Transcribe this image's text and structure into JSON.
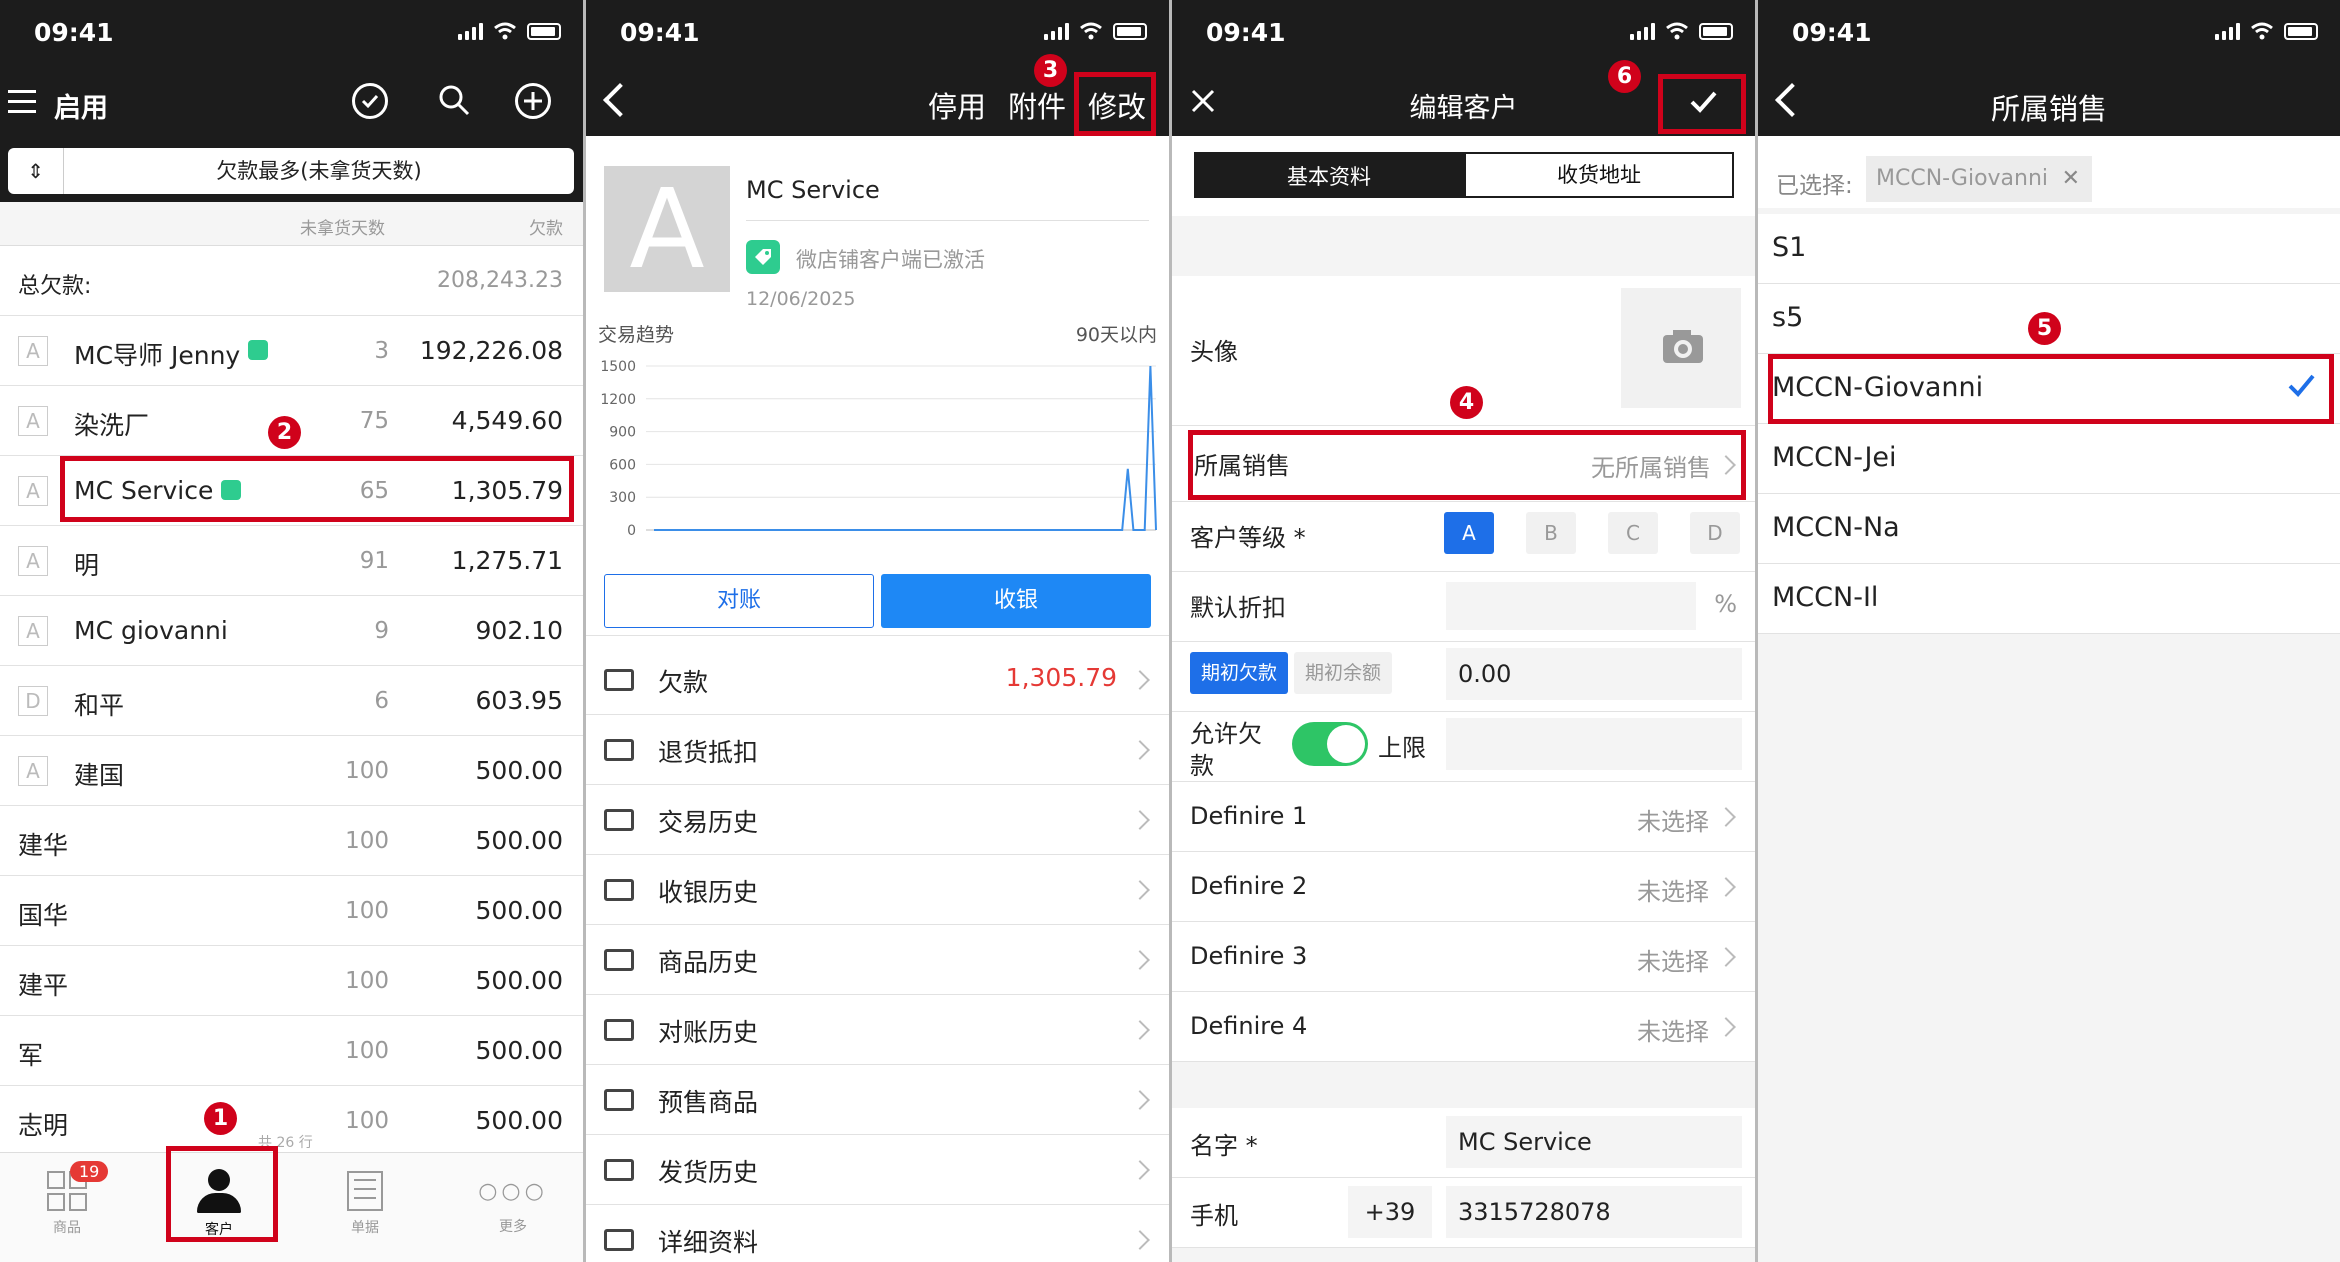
{
  "status_time": "09:41",
  "screen1": {
    "title": "启用",
    "sort_label": "欠款最多(未拿货天数)",
    "col_days": "未拿货天数",
    "col_debt": "欠款",
    "total_label": "总欠款:",
    "total_value": "208,243.23",
    "customers": [
      {
        "badge": "A",
        "name": "MC导师 Jenny",
        "verified": true,
        "days": "3",
        "amount": "192,226.08"
      },
      {
        "badge": "A",
        "name": "染洗厂",
        "verified": false,
        "days": "75",
        "amount": "4,549.60"
      },
      {
        "badge": "A",
        "name": "MC Service",
        "verified": true,
        "days": "65",
        "amount": "1,305.79"
      },
      {
        "badge": "A",
        "name": "明",
        "verified": false,
        "days": "91",
        "amount": "1,275.71"
      },
      {
        "badge": "A",
        "name": "MC giovanni",
        "verified": false,
        "days": "9",
        "amount": "902.10"
      },
      {
        "badge": "D",
        "name": "和平",
        "verified": false,
        "days": "6",
        "amount": "603.95"
      },
      {
        "badge": "A",
        "name": "建国",
        "verified": false,
        "days": "100",
        "amount": "500.00"
      },
      {
        "badge": "",
        "name": "建华",
        "verified": false,
        "days": "100",
        "amount": "500.00"
      },
      {
        "badge": "",
        "name": "国华",
        "verified": false,
        "days": "100",
        "amount": "500.00"
      },
      {
        "badge": "",
        "name": "建平",
        "verified": false,
        "days": "100",
        "amount": "500.00"
      },
      {
        "badge": "",
        "name": "军",
        "verified": false,
        "days": "100",
        "amount": "500.00"
      },
      {
        "badge": "",
        "name": "志明",
        "verified": false,
        "days": "100",
        "amount": "500.00"
      }
    ],
    "row_count": "共 26 行",
    "tabs": [
      {
        "label": "商品",
        "icon": "grid-icon"
      },
      {
        "label": "客户",
        "icon": "person-icon"
      },
      {
        "label": "单据",
        "icon": "list-doc-icon"
      },
      {
        "label": "更多",
        "icon": "more-dots-icon"
      }
    ],
    "tab_badge": "19",
    "marks": {
      "m1": "1",
      "m2": "2"
    }
  },
  "screen2": {
    "actions": {
      "disable": "停用",
      "attach": "附件",
      "edit": "修改"
    },
    "avatar_letter": "A",
    "customer_name": "MC Service",
    "activated": "微店铺客户端已激活",
    "date": "12/06/2025",
    "trend_label": "交易趋势",
    "trend_range": "90天以内",
    "chart_data": {
      "type": "line",
      "y_ticks": [
        "1500",
        "1200",
        "900",
        "600",
        "300",
        "0"
      ],
      "ylim": [
        0,
        1500
      ],
      "values": [
        0,
        0,
        0,
        0,
        0,
        0,
        0,
        0,
        0,
        0,
        0,
        0,
        0,
        0,
        0,
        0,
        0,
        0,
        0,
        0,
        0,
        0,
        0,
        0,
        0,
        0,
        0,
        0,
        0,
        0,
        0,
        0,
        0,
        0,
        0,
        0,
        0,
        0,
        0,
        0,
        0,
        0,
        0,
        0,
        0,
        0,
        0,
        0,
        0,
        0,
        0,
        0,
        0,
        0,
        0,
        0,
        0,
        0,
        0,
        0,
        0,
        0,
        0,
        0,
        0,
        0,
        0,
        0,
        0,
        0,
        0,
        0,
        0,
        0,
        0,
        0,
        0,
        0,
        0,
        0,
        0,
        0,
        0,
        0,
        560,
        0,
        0,
        0,
        1500,
        0
      ]
    },
    "btn_reconcile": "对账",
    "btn_collect": "收银",
    "menu": [
      {
        "icon": "money-icon",
        "label": "欠款",
        "value": "1,305.79"
      },
      {
        "icon": "bag-icon",
        "label": "退货抵扣",
        "value": ""
      },
      {
        "icon": "list-icon",
        "label": "交易历史",
        "value": ""
      },
      {
        "icon": "cash-hand-icon",
        "label": "收银历史",
        "value": ""
      },
      {
        "icon": "cart-icon",
        "label": "商品历史",
        "value": ""
      },
      {
        "icon": "receipt-icon",
        "label": "对账历史",
        "value": ""
      },
      {
        "icon": "history-icon",
        "label": "预售商品",
        "value": ""
      },
      {
        "icon": "truck-icon",
        "label": "发货历史",
        "value": ""
      },
      {
        "icon": "card-icon",
        "label": "详细资料",
        "value": ""
      }
    ],
    "marks": {
      "m3": "3"
    }
  },
  "screen3": {
    "title": "编辑客户",
    "seg_basic": "基本资料",
    "seg_address": "收货地址",
    "avatar_label": "头像",
    "sales_label": "所属销售",
    "sales_value": "无所属销售",
    "level_label": "客户等级 *",
    "levels": [
      "A",
      "B",
      "C",
      "D"
    ],
    "discount_label": "默认折扣",
    "discount_unit": "%",
    "opening_debt": "期初欠款",
    "opening_balance": "期初余额",
    "opening_value": "0.00",
    "allow_debt_line1": "允许欠",
    "allow_debt_line2": "款",
    "limit_label": "上限",
    "defines": [
      {
        "label": "Definire 1",
        "value": "未选择"
      },
      {
        "label": "Definire 2",
        "value": "未选择"
      },
      {
        "label": "Definire 3",
        "value": "未选择"
      },
      {
        "label": "Definire 4",
        "value": "未选择"
      }
    ],
    "name_label": "名字 *",
    "name_value": "MC Service",
    "phone_label": "手机",
    "phone_prefix": "+39",
    "phone_value": "3315728078",
    "marks": {
      "m4": "4",
      "m6": "6"
    }
  },
  "screen4": {
    "title": "所属销售",
    "selected_label": "已选择:",
    "selected_chip": "MCCN-Giovanni",
    "items": [
      "S1",
      "s5",
      "MCCN-Giovanni",
      "MCCN-Jei",
      "MCCN-Na",
      "MCCN-Il"
    ],
    "marks": {
      "m5": "5"
    }
  }
}
